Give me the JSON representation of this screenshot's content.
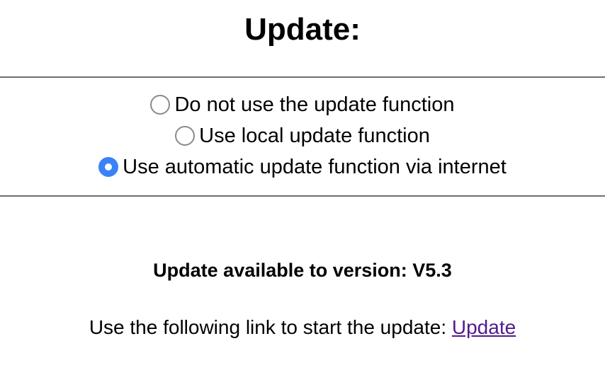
{
  "title": "Update:",
  "update_mode": {
    "options": [
      {
        "label": "Do not use the update function",
        "checked": false
      },
      {
        "label": "Use local update function",
        "checked": false
      },
      {
        "label": "Use automatic update function via internet",
        "checked": true
      }
    ]
  },
  "status": {
    "available_text": "Update available to version: V5.3"
  },
  "link_section": {
    "prompt": "Use the following link to start the update: ",
    "link_label": "Update"
  },
  "colors": {
    "radio_checked": "#3a82f7",
    "link_visited": "#551a8b",
    "divider": "#6f6f6f"
  }
}
